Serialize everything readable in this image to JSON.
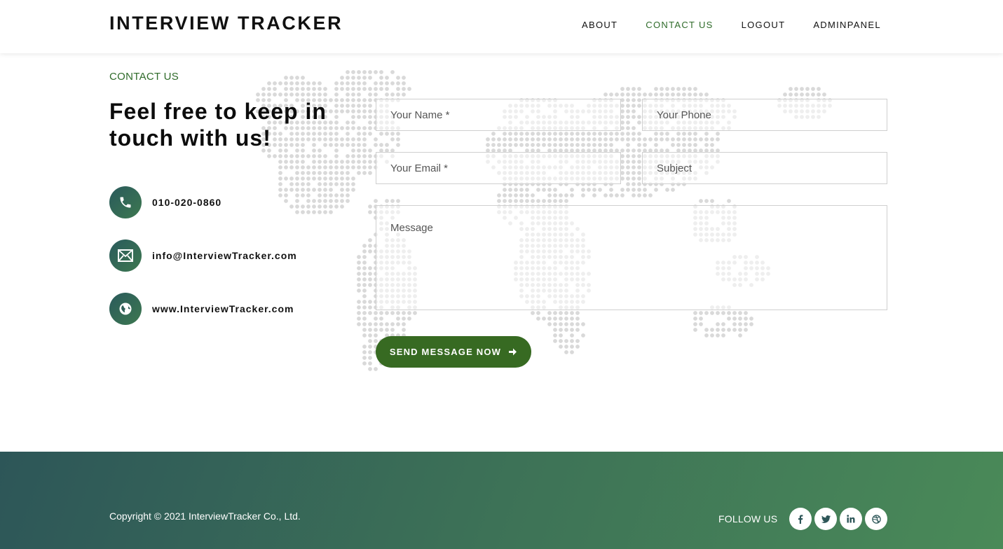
{
  "header": {
    "brand": "INTERVIEW TRACKER",
    "nav": [
      "ABOUT",
      "CONTACT US",
      "LOGOUT",
      "ADMINPANEL"
    ],
    "active_nav": "CONTACT US"
  },
  "contact": {
    "section_label": "CONTACT US",
    "headline": "Feel free to keep in touch with us!",
    "phone": "010-020-0860",
    "email": "info@InterviewTracker.com",
    "website": "www.InterviewTracker.com"
  },
  "form": {
    "name_placeholder": "Your Name *",
    "phone_placeholder": "Your Phone",
    "email_placeholder": "Your Email *",
    "subject_placeholder": "Subject",
    "message_placeholder": "Message",
    "send_label": "SEND MESSAGE NOW"
  },
  "footer": {
    "copyright": "Copyright © 2021 InterviewTracker Co., Ltd.",
    "follow_label": "FOLLOW US",
    "socials": [
      "facebook-icon",
      "twitter-icon",
      "linkedin-icon",
      "dribbble-icon"
    ]
  },
  "colors": {
    "accent": "#2f6b2a",
    "button": "#376a22",
    "footer_start": "#2d5658",
    "footer_end": "#4a8a58"
  }
}
